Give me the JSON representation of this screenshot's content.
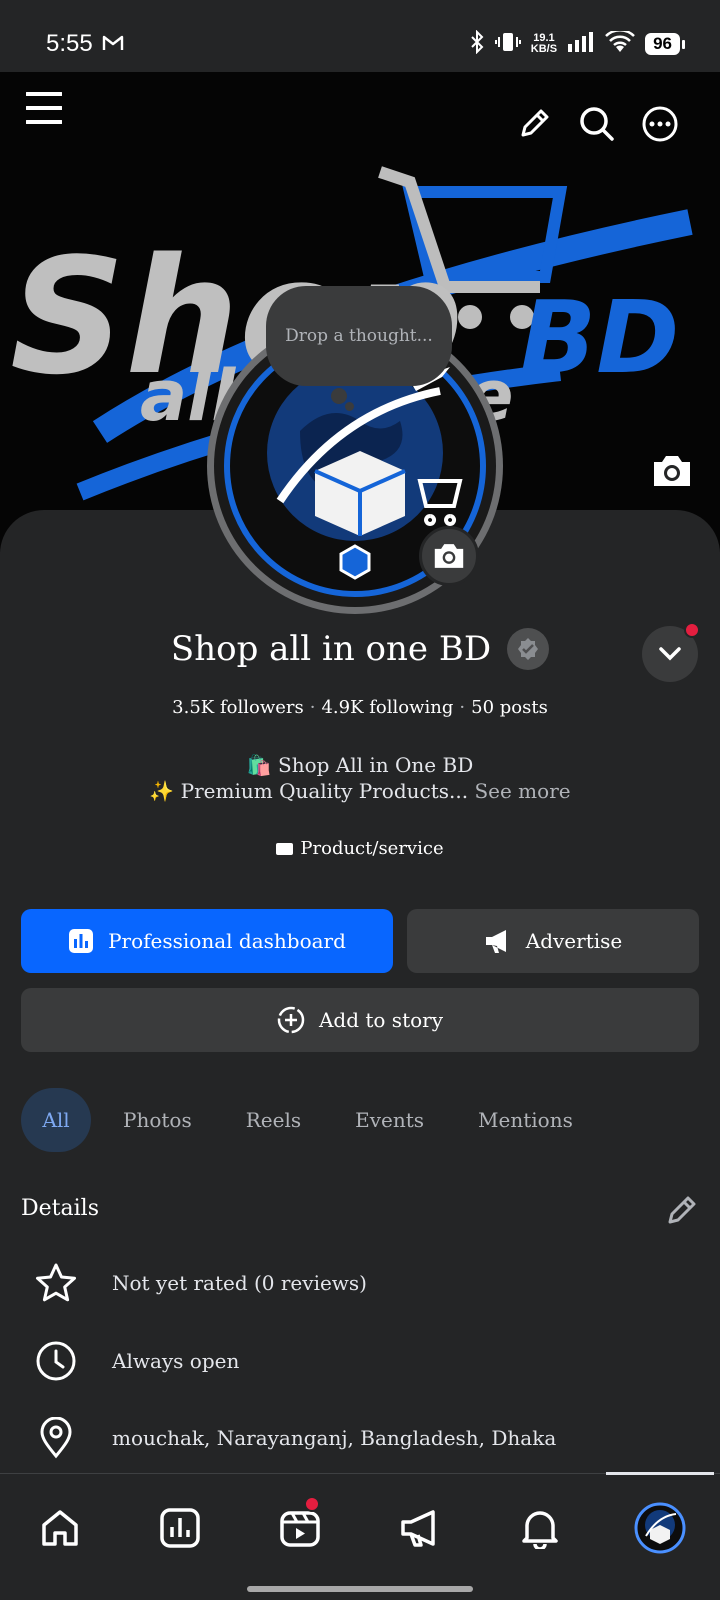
{
  "status_bar": {
    "time": "5:55",
    "net_speed_value": "19.1",
    "net_speed_unit": "KB/S",
    "battery": "96"
  },
  "cover": {
    "brand_text_1": "Shop",
    "brand_text_2": "all",
    "brand_text_3": "e",
    "brand_text_4": "BD"
  },
  "thought_bubble": {
    "placeholder": "Drop a thought..."
  },
  "profile": {
    "name": "Shop all in one BD",
    "followers": "3.5K followers",
    "following": "4.9K following",
    "posts": "50 posts",
    "separator": "·",
    "bio_line1": "🛍️ Shop All in One BD",
    "bio_line2": "✨ Premium Quality Products...",
    "see_more": "See more",
    "category": "Product/service"
  },
  "actions": {
    "dashboard": "Professional dashboard",
    "advertise": "Advertise",
    "add_story": "Add to story"
  },
  "tabs": [
    "All",
    "Photos",
    "Reels",
    "Events",
    "Mentions"
  ],
  "details": {
    "title": "Details",
    "rating": "Not yet rated (0 reviews)",
    "hours": "Always open",
    "location": "mouchak, Narayanganj, Bangladesh, Dhaka"
  },
  "colors": {
    "accent": "#0866ff",
    "background": "#242526",
    "surface": "#3a3b3c",
    "notification": "#e41e3f"
  },
  "icons": {
    "top_bar": [
      "menu-icon",
      "pencil-icon",
      "search-icon",
      "more-icon"
    ],
    "bottom_nav": [
      "home-icon",
      "dashboard-icon",
      "reels-icon",
      "megaphone-icon",
      "bell-icon",
      "profile-avatar"
    ]
  }
}
